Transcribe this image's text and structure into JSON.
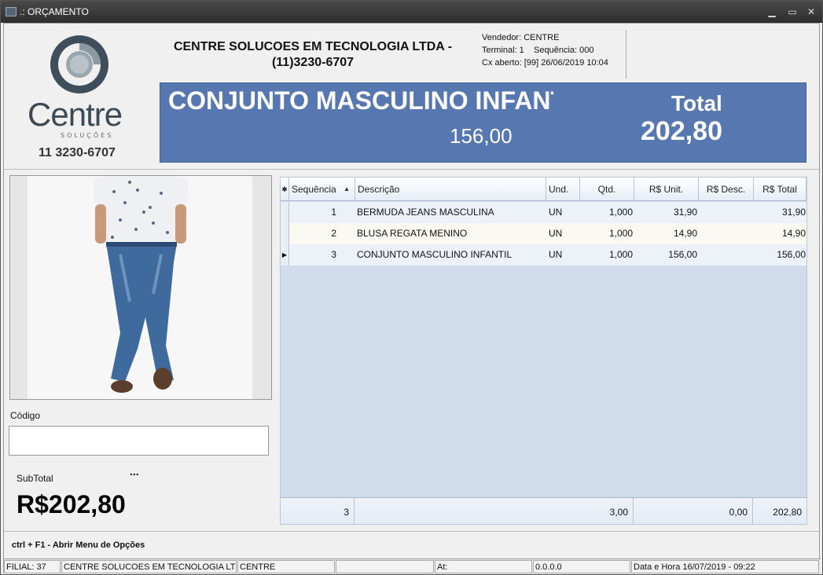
{
  "window": {
    "title": ".: ORÇAMENTO"
  },
  "logo": {
    "name": "Centre",
    "subtitle": "SOLUÇÕES",
    "phone": "11 3230-6707"
  },
  "company": {
    "line1": "CENTRE SOLUCOES EM TECNOLOGIA LTDA -",
    "line2": "(11)3230-6707"
  },
  "session": {
    "vendedor": "Vendedor: CENTRE",
    "terminal": "Terminal: 1",
    "sequencia": "Sequência: 000",
    "caixa": "Cx aberto: [99] 26/06/2019 10:04"
  },
  "banner": {
    "product_name": "CONJUNTO MASCULINO INFANTIL",
    "product_price": "156,00",
    "total_label": "Total",
    "total_value": "202,80"
  },
  "form": {
    "codigo_label": "Código",
    "codigo_value": "",
    "subtotal_label": "SubTotal",
    "dots": "...",
    "subtotal_value": "R$202,80"
  },
  "grid": {
    "columns": [
      "Sequência",
      "Descrição",
      "Und.",
      "Qtd.",
      "R$ Unit.",
      "R$ Desc.",
      "R$ Total"
    ],
    "rows": [
      {
        "seq": "1",
        "desc": "BERMUDA JEANS MASCULINA",
        "und": "UN",
        "qtd": "1,000",
        "unit": "31,90",
        "descv": "",
        "total": "31,90"
      },
      {
        "seq": "2",
        "desc": "BLUSA REGATA MENINO",
        "und": "UN",
        "qtd": "1,000",
        "unit": "14,90",
        "descv": "",
        "total": "14,90"
      },
      {
        "seq": "3",
        "desc": "CONJUNTO MASCULINO INFANTIL",
        "und": "UN",
        "qtd": "1,000",
        "unit": "156,00",
        "descv": "",
        "total": "156,00"
      }
    ],
    "footer": {
      "count": "3",
      "qtd": "3,00",
      "desc": "0,00",
      "total": "202,80"
    }
  },
  "shortcut": "ctrl + F1 - Abrir Menu de Opções",
  "status": {
    "filial": "FILIAL: 37",
    "empresa": "CENTRE SOLUCOES EM TECNOLOGIA LTDA",
    "usuario": "CENTRE",
    "vazio": "",
    "at": "At:",
    "ip": "0.0.0.0",
    "datahora": "Data e Hora 16/07/2019 - 09:22"
  },
  "colors": {
    "banner": "#5677b0",
    "grid_bg": "#d0dceb"
  }
}
